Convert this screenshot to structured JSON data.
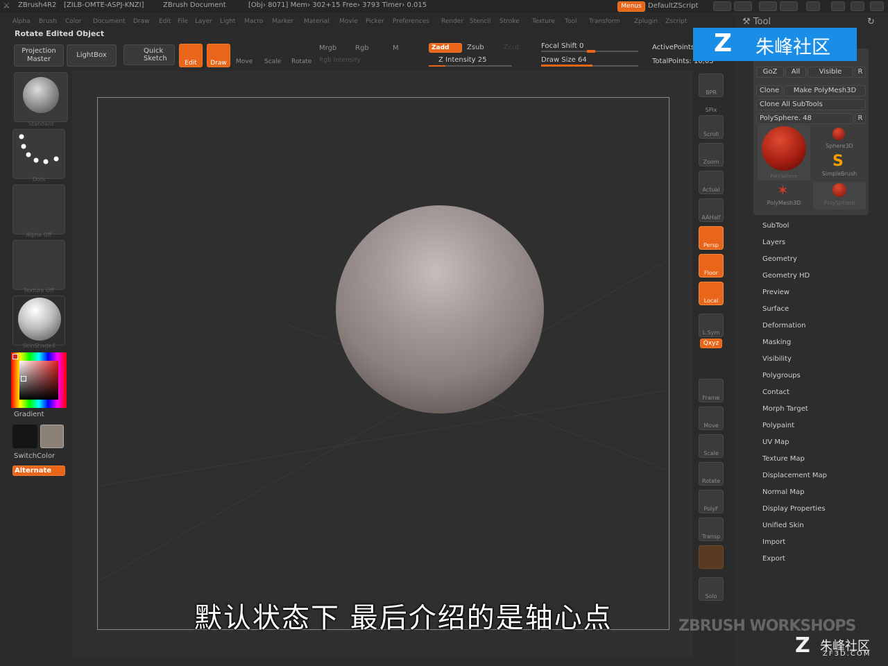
{
  "titlebar": {
    "app": "ZBrush4R2",
    "build": "[ZILB-OMTE-ASPJ-KNZI]",
    "doc": "ZBrush Document",
    "stats": "[Obj› 8071] Mem› 302+15 Free› 3793 Timer› 0.015",
    "menus_label": "Menus",
    "script_label": "DefaultZScript"
  },
  "menubar": [
    "Alpha",
    "Brush",
    "Color",
    "Document",
    "Draw",
    "Edit",
    "File",
    "Layer",
    "Light",
    "Macro",
    "Marker",
    "Material",
    "Movie",
    "Picker",
    "Preferences",
    "Render",
    "Stencil",
    "Stroke",
    "Texture",
    "Tool",
    "Transform",
    "Zplugin",
    "Zscript"
  ],
  "status": {
    "rotate_edited": "Rotate Edited Object"
  },
  "toolbar": {
    "projection_master": "Projection Master",
    "lightbox": "LightBox",
    "quick_sketch": "Quick Sketch",
    "edit": "Edit",
    "draw": "Draw",
    "move": "Move",
    "scale": "Scale",
    "rotate": "Rotate",
    "mrgb": "Mrgb",
    "rgb": "Rgb",
    "m": "M",
    "rgb_intensity": "Rgb Intensity",
    "zadd": "Zadd",
    "zsub": "Zsub",
    "zcut": "Zcut",
    "z_intensity": "Z Intensity 25",
    "focal_shift": "Focal Shift 0",
    "draw_size": "Draw Size 64",
    "active_points": "ActivePoints",
    "total_points": "TotalPoints: 16,05"
  },
  "left": {
    "brush_caption": "Standard",
    "stroke_caption": "Dots",
    "alpha_caption": "Alpha Off",
    "texture_caption": "Texture Off",
    "material_caption": "SkinShade4",
    "gradient": "Gradient",
    "switch_color": "SwitchColor",
    "alternate": "Alternate"
  },
  "shelf": [
    {
      "label": "BPR",
      "on": false
    },
    {
      "label": "SPix",
      "on": false
    },
    {
      "label": "Scroll",
      "on": false
    },
    {
      "label": "Zoom",
      "on": false
    },
    {
      "label": "Actual",
      "on": false
    },
    {
      "label": "AAHalf",
      "on": false
    },
    {
      "label": "Persp",
      "on": true
    },
    {
      "label": "Floor",
      "on": true
    },
    {
      "label": "Local",
      "on": true
    },
    {
      "label": "L.Sym",
      "on": false
    },
    {
      "label": "Frame",
      "on": false
    },
    {
      "label": "Move",
      "on": false
    },
    {
      "label": "Scale",
      "on": false
    },
    {
      "label": "Rotate",
      "on": false
    },
    {
      "label": "PolyF",
      "on": false
    },
    {
      "label": "Transp",
      "on": false
    },
    {
      "label": "Solo",
      "on": false
    }
  ],
  "shelf_xyz": "Qxyz",
  "tool": {
    "title": "Tool",
    "goz": "GoZ",
    "all": "All",
    "visible": "Visible",
    "r": "R",
    "clone": "Clone",
    "make_polymesh": "Make PolyMesh3D",
    "clone_all": "Clone All SubTools",
    "polysphere": "PolySphere. 48",
    "thumbs": [
      "PolySphere",
      "Sphere3D",
      "SimpleBrush",
      "PolyMesh3D",
      "PolySphere"
    ],
    "items": [
      "SubTool",
      "Layers",
      "Geometry",
      "Geometry HD",
      "Preview",
      "Surface",
      "Deformation",
      "Masking",
      "Visibility",
      "Polygroups",
      "Contact",
      "Morph Target",
      "Polypaint",
      "UV Map",
      "Texture Map",
      "Displacement Map",
      "Normal Map",
      "Display Properties",
      "Unified Skin",
      "Import",
      "Export"
    ]
  },
  "overlay": {
    "subtitle": "默认状态下    最后介绍的是轴心点",
    "watermark_top": "朱峰社区",
    "workshops": "ZBRUSH WORKSHOPS",
    "zf_brand": "朱峰社区",
    "zf_url": "ZF3D.COM"
  },
  "colors": {
    "accent": "#e8651a",
    "watermark_blue": "#1a8ee6"
  }
}
